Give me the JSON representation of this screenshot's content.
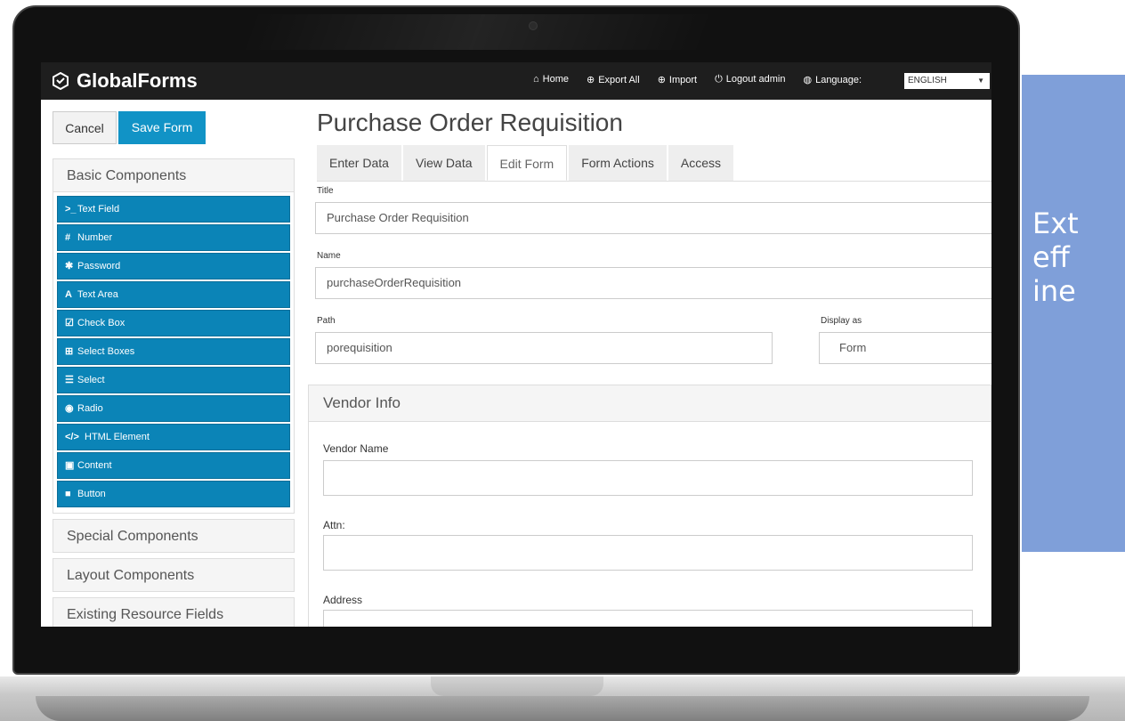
{
  "app": {
    "brand": "GlobalForms"
  },
  "topnav": {
    "home": "Home",
    "export_all": "Export All",
    "import": "Import",
    "logout": "Logout admin",
    "language_label": "Language:",
    "language_value": "ENGLISH"
  },
  "sidebar": {
    "cancel": "Cancel",
    "save": "Save Form",
    "basic_title": "Basic Components",
    "components": [
      {
        "icon": ">_",
        "label": "Text Field"
      },
      {
        "icon": "#",
        "label": "Number"
      },
      {
        "icon": "✱",
        "label": "Password"
      },
      {
        "icon": "A",
        "label": "Text Area"
      },
      {
        "icon": "☑",
        "label": "Check Box"
      },
      {
        "icon": "⊞",
        "label": "Select Boxes"
      },
      {
        "icon": "☰",
        "label": "Select"
      },
      {
        "icon": "◉",
        "label": "Radio"
      },
      {
        "icon": "</>",
        "label": "HTML Element"
      },
      {
        "icon": "▣",
        "label": "Content"
      },
      {
        "icon": "■",
        "label": "Button"
      }
    ],
    "special": "Special Components",
    "layout": "Layout Components",
    "existing": "Existing Resource Fields"
  },
  "main": {
    "title": "Purchase Order Requisition",
    "tabs": [
      "Enter Data",
      "View Data",
      "Edit Form",
      "Form Actions",
      "Access"
    ],
    "active_tab": "Edit Form",
    "fields": {
      "title_label": "Title",
      "title_value": "Purchase Order Requisition",
      "name_label": "Name",
      "name_value": "purchaseOrderRequisition",
      "path_label": "Path",
      "path_value": "porequisition",
      "display_label": "Display as",
      "display_value": "Form"
    },
    "vendor": {
      "heading": "Vendor Info",
      "vendor_name": "Vendor Name",
      "attn": "Attn:",
      "address": "Address"
    }
  },
  "side_panel": {
    "lines": [
      "Ext",
      "eff",
      "ine"
    ]
  },
  "colors": {
    "primary": "#1193c6",
    "component": "#0b84b7",
    "topbar": "#1e1e1e",
    "side_panel": "#7f9fd9"
  }
}
